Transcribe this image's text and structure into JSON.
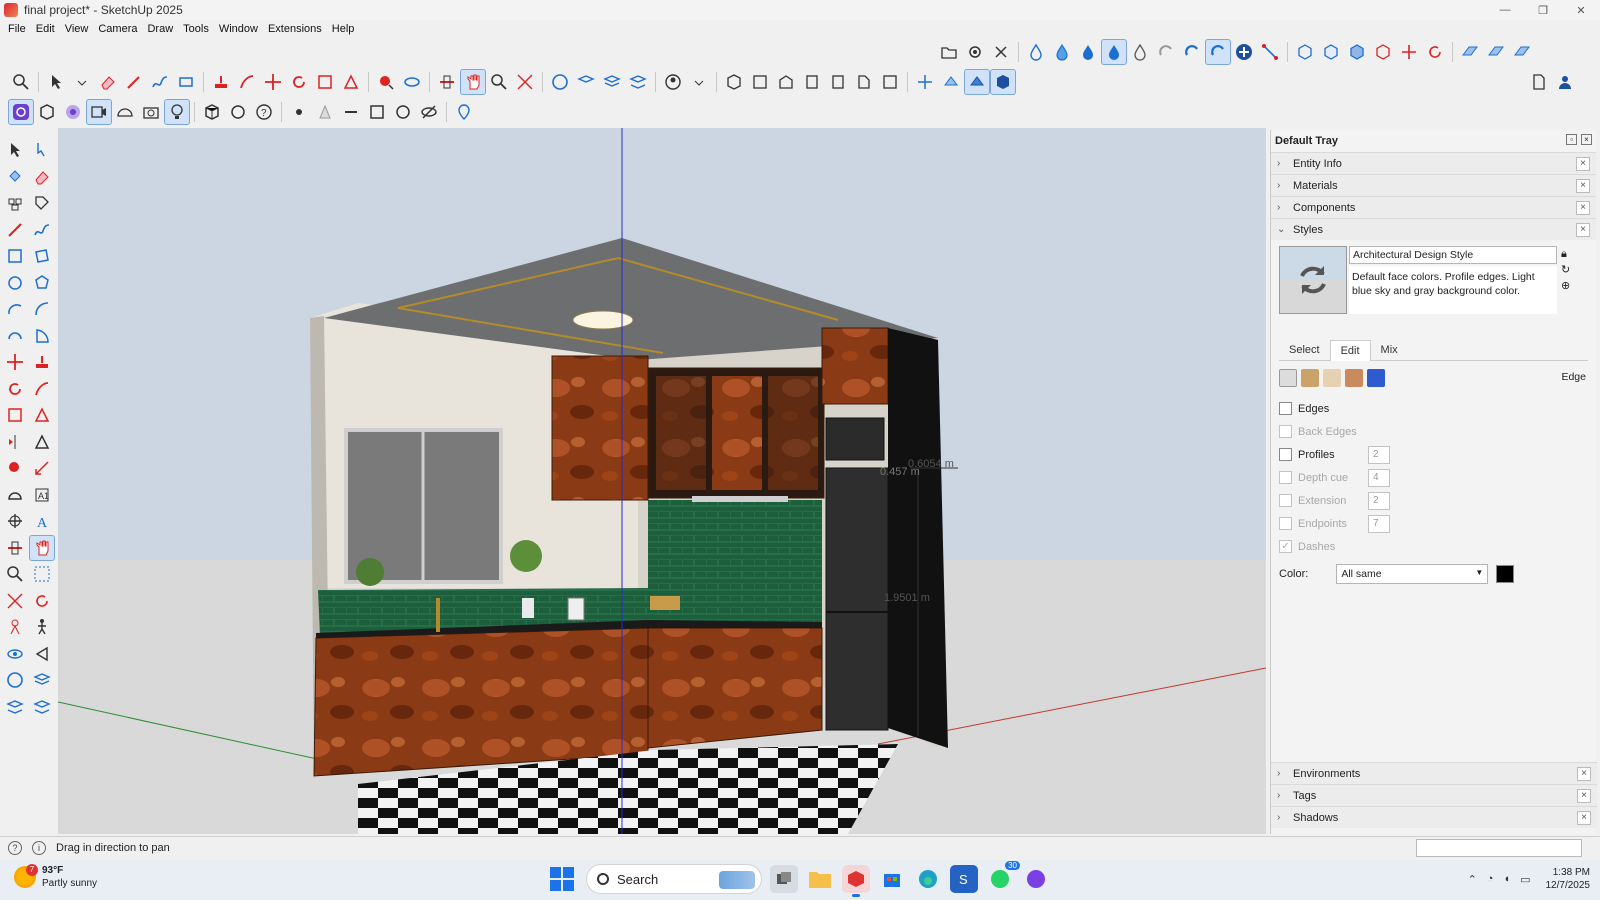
{
  "window": {
    "title": "final project* - SketchUp 2025",
    "controls": [
      "—",
      "❐",
      "✕"
    ]
  },
  "menu": [
    "File",
    "Edit",
    "View",
    "Camera",
    "Draw",
    "Tools",
    "Window",
    "Extensions",
    "Help"
  ],
  "viewport": {
    "dimension_labels": [
      "0.6054 m",
      "0.457 m",
      "1.9501 m"
    ],
    "colors": {
      "sky": "#ccd6e2",
      "ground": "#d9d9d9",
      "wood": "#8a3a14",
      "tile": "#1d5e3d",
      "fridge": "#2e2e2e"
    }
  },
  "tray": {
    "title": "Default Tray",
    "panels_top": [
      "Entity Info",
      "Materials",
      "Components"
    ],
    "styles": {
      "label": "Styles",
      "style_name": "Architectural Design Style",
      "style_desc": "Default face colors. Profile edges. Light blue sky and gray background color.",
      "tabs": [
        "Select",
        "Edit",
        "Mix"
      ],
      "section_title": "Edge",
      "options": [
        {
          "label": "Edges",
          "checked": false,
          "disabled": false
        },
        {
          "label": "Back Edges",
          "checked": false,
          "disabled": true
        },
        {
          "label": "Profiles",
          "checked": false,
          "disabled": false,
          "value": "2"
        },
        {
          "label": "Depth cue",
          "checked": false,
          "disabled": true,
          "value": "4"
        },
        {
          "label": "Extension",
          "checked": false,
          "disabled": true,
          "value": "2"
        },
        {
          "label": "Endpoints",
          "checked": false,
          "disabled": true,
          "value": "7"
        },
        {
          "label": "Dashes",
          "checked": true,
          "disabled": true
        }
      ],
      "color_label": "Color:",
      "color_value": "All same",
      "color_swatch": "#000000"
    },
    "panels_bottom": [
      "Environments",
      "Tags",
      "Shadows"
    ]
  },
  "status": {
    "text": "Drag in direction to pan"
  },
  "taskbar": {
    "weather_temp": "93°F",
    "weather_desc": "Partly sunny",
    "weather_badge": "7",
    "search_label": "Search",
    "whatsapp_badge": "30",
    "time": "1:38 PM",
    "date": "12/7/2025"
  }
}
